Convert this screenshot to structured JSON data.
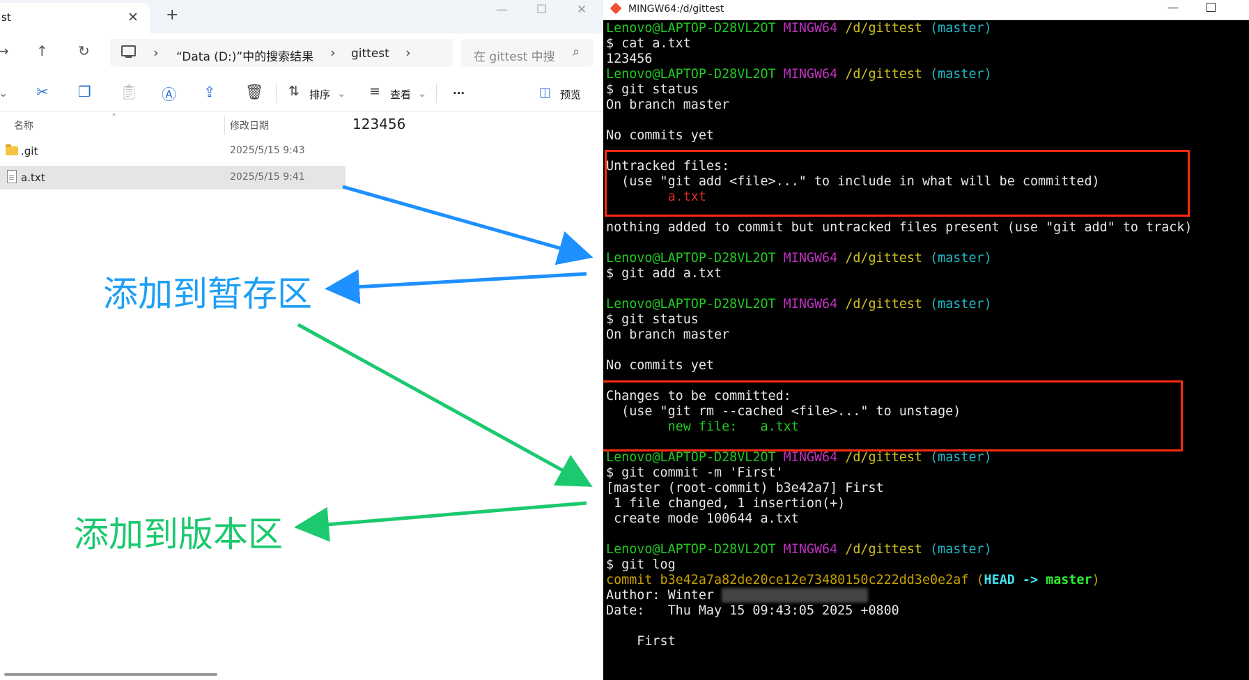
{
  "explorer": {
    "tab_title": "st",
    "tab_close": "✕",
    "new_tab": "+",
    "breadcrumbs": [
      "“Data (D:)”中的搜索结果",
      "gittest"
    ],
    "search_placeholder": "在 gittest 中搜",
    "toolbar": {
      "sort_label": "排序",
      "view_label": "查看",
      "more_label": "···",
      "preview_label": "预览"
    },
    "columns": {
      "name": "名称",
      "date": "修改日期"
    },
    "files": [
      {
        "name": ".git",
        "date": "2025/5/15 9:43",
        "type": "folder"
      },
      {
        "name": "a.txt",
        "date": "2025/5/15 9:41",
        "type": "file"
      }
    ],
    "preview_content": "123456"
  },
  "annotations": {
    "staging": "添加到暂存区",
    "repository": "添加到版本区"
  },
  "terminal": {
    "title": "MINGW64:/d/gittest",
    "prompt": {
      "user": "Lenovo@LAPTOP-D28VL2OT",
      "env": "MINGW64",
      "path": "/d/gittest",
      "branch": "(master)"
    },
    "lines": {
      "l2": "$ cat a.txt",
      "l3": "123456",
      "l5": "$ git status",
      "l6": "On branch master",
      "l8": "No commits yet",
      "l10": "Untracked files:",
      "l11": "  (use \"git add <file>...\" to include in what will be committed)",
      "l12": "        a.txt",
      "l14": "nothing added to commit but untracked files present (use \"git add\" to track)",
      "l16": "$ git add a.txt",
      "l19": "$ git status",
      "l20": "On branch master",
      "l22": "No commits yet",
      "l24": "Changes to be committed:",
      "l25": "  (use \"git rm --cached <file>...\" to unstage)",
      "l26": "        new file:   a.txt",
      "l29": "$ git commit -m 'First'",
      "l30": "[master (root-commit) b3e42a7] First",
      "l31": " 1 file changed, 1 insertion(+)",
      "l32": " create mode 100644 a.txt",
      "l35": "$ git log",
      "l36_commit": "commit b3e42a7a82de20ce12e73480150c222dd3e0e2af",
      "l36_head": "HEAD",
      "l36_arrow": "->",
      "l36_master": "master",
      "l37": "Author: Winter",
      "l38": "Date:   Thu May 15 09:43:05 2025 +0800",
      "l40": "    First"
    }
  }
}
